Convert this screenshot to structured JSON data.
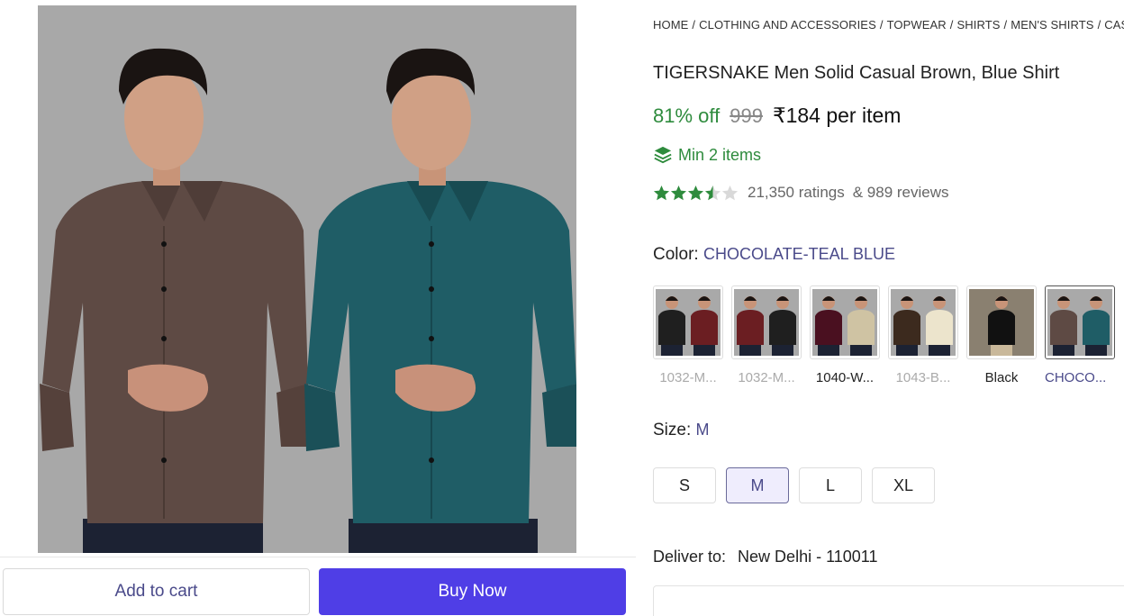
{
  "breadcrumb": {
    "items": [
      "HOME",
      "CLOTHING AND ACCESSORIES",
      "TOPWEAR",
      "SHIRTS",
      "MEN'S SHIRTS",
      "CASUAL"
    ],
    "separator": "/"
  },
  "product": {
    "title": "TIGERSNAKE Men Solid Casual Brown, Blue Shirt",
    "discount": "81% off",
    "mrp": "999",
    "price": "₹184 per item",
    "min_items": "Min 2 items",
    "rating_value": 3.5,
    "ratings": "21,350 ratings",
    "reviews": "& 989 reviews"
  },
  "color": {
    "label": "Color:",
    "selected": "CHOCOLATE-TEAL BLUE",
    "options": [
      {
        "caption": "1032-M...",
        "available": false,
        "shirts": [
          "#1f1f1f",
          "#6b1e22"
        ]
      },
      {
        "caption": "1032-M...",
        "available": false,
        "shirts": [
          "#6b1e22",
          "#1f1f1f"
        ]
      },
      {
        "caption": "1040-W...",
        "available": true,
        "shirts": [
          "#4a1020",
          "#cfc3a3"
        ]
      },
      {
        "caption": "1043-B...",
        "available": false,
        "shirts": [
          "#3c2a1e",
          "#ece4cc"
        ]
      },
      {
        "caption": "Black",
        "available": true,
        "shirts": [
          "#111111"
        ]
      },
      {
        "caption": "CHOCO...",
        "available": true,
        "selected": true,
        "shirts": [
          "#5e4a44",
          "#1f5d66"
        ]
      }
    ]
  },
  "size": {
    "label": "Size:",
    "selected": "M",
    "options": [
      "S",
      "M",
      "L",
      "XL"
    ]
  },
  "delivery": {
    "label": "Deliver to:",
    "location": "New Delhi - 110011"
  },
  "actions": {
    "add_to_cart": "Add to cart",
    "buy_now": "Buy Now"
  },
  "colors": {
    "accent": "#4f3ee6",
    "green": "#2e8b3d",
    "link": "#4a4a8a",
    "image_bg": "#a9a9a9",
    "shirt_brown": "#5e4a44",
    "shirt_teal": "#1f5d66"
  },
  "icons": [
    "layers-icon",
    "star-icon"
  ]
}
